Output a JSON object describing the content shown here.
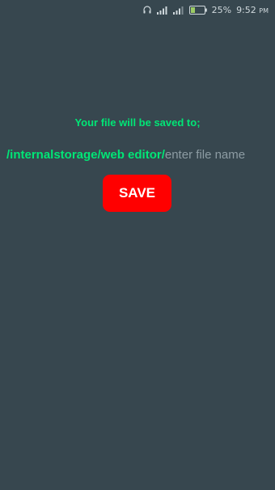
{
  "status_bar": {
    "battery_percent": "25%",
    "time": "9:52",
    "ampm": "PM",
    "icons": [
      "headphones-icon",
      "signal-icon",
      "signal-icon",
      "battery-icon"
    ]
  },
  "main": {
    "save_to_label": "Your file will be saved to;",
    "path_prefix": "/internalstorage/web editor/",
    "filename_placeholder": "enter file name",
    "filename_value": "",
    "save_button_label": "SAVE"
  },
  "colors": {
    "background": "#37474f",
    "accent_green": "#00e676",
    "button_red": "#ff0000"
  }
}
